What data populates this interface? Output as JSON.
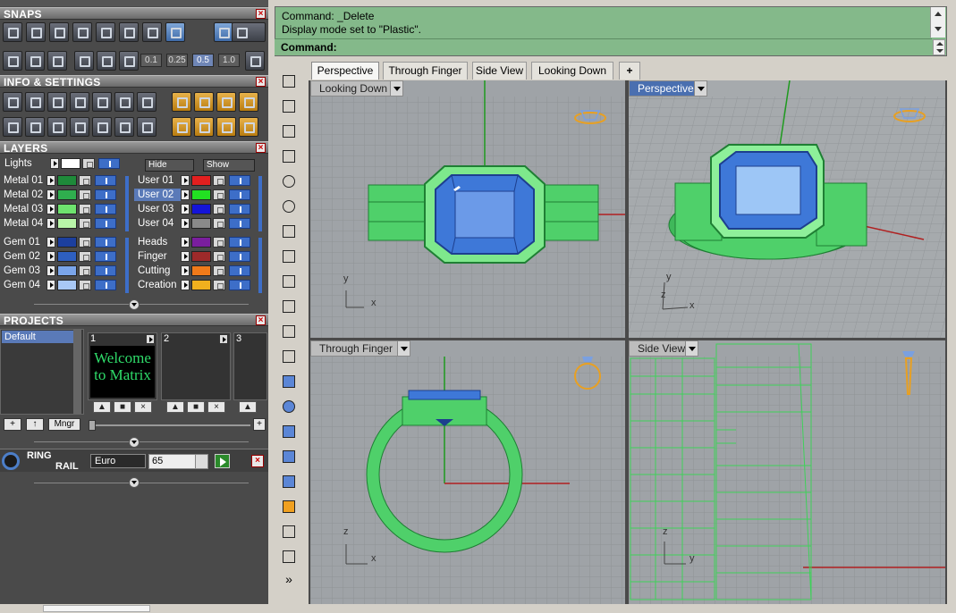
{
  "snaps": {
    "title": "SNAPS",
    "values": [
      "0.1",
      "0.25",
      "0.5",
      "1.0"
    ],
    "selected_value": "0.5"
  },
  "info": {
    "title": "INFO & SETTINGS"
  },
  "layers": {
    "title": "LAYERS",
    "lights_label": "Lights",
    "hide_label": "Hide",
    "show_label": "Show",
    "left": [
      {
        "name": "Metal 01",
        "color": "#1e8a3a"
      },
      {
        "name": "Metal 02",
        "color": "#2fae4e"
      },
      {
        "name": "Metal 03",
        "color": "#6ee36e"
      },
      {
        "name": "Metal 04",
        "color": "#b8f5a8"
      },
      {
        "name": "Gem 01",
        "color": "#1c3f9e"
      },
      {
        "name": "Gem 02",
        "color": "#2e5fc0"
      },
      {
        "name": "Gem 03",
        "color": "#7aa5ea"
      },
      {
        "name": "Gem 04",
        "color": "#a8c8f5"
      }
    ],
    "right": [
      {
        "name": "User 01",
        "color": "#e21f1f"
      },
      {
        "name": "User 02",
        "color": "#22e022"
      },
      {
        "name": "User 03",
        "color": "#1414d8"
      },
      {
        "name": "User 04",
        "color": "#8a8a8a"
      },
      {
        "name": "Heads",
        "color": "#7a1e9e"
      },
      {
        "name": "Finger",
        "color": "#9e2a2a"
      },
      {
        "name": "Cutting",
        "color": "#f07a1a"
      },
      {
        "name": "Creation",
        "color": "#f0b01e"
      }
    ],
    "selected": "User 02"
  },
  "projects": {
    "title": "PROJECTS",
    "items": [
      "Default"
    ],
    "slots": [
      {
        "num": "1",
        "preview": "Welcome to Matrix"
      },
      {
        "num": "2",
        "preview": ""
      },
      {
        "num": "3",
        "preview": ""
      }
    ],
    "mngr_label": "Mngr"
  },
  "ring_rail": {
    "title_line1": "RING",
    "title_line2": "RAIL",
    "size_system": "Euro",
    "size_value": "65"
  },
  "command": {
    "lines": [
      "Command: _Delete",
      "Display mode set to \"Plastic\"."
    ],
    "prompt": "Command:"
  },
  "tabs": [
    {
      "label": "Perspective",
      "active": true
    },
    {
      "label": "Through Finger",
      "active": false
    },
    {
      "label": "Side View",
      "active": false
    },
    {
      "label": "Looking Down",
      "active": false
    },
    {
      "label": "+",
      "active": false
    }
  ],
  "viewports": [
    {
      "label": "Looking Down",
      "active": false,
      "axes": [
        "y",
        "x"
      ]
    },
    {
      "label": "Perspective",
      "active": true,
      "axes": [
        "y",
        "z",
        "x"
      ]
    },
    {
      "label": "Through Finger",
      "active": false,
      "axes": [
        "z",
        "x"
      ]
    },
    {
      "label": "Side View",
      "active": false,
      "axes": [
        "z",
        "y"
      ]
    }
  ],
  "colors": {
    "metal": "#4fd06a",
    "gem": "#3e78d8",
    "grid": "#8f9396",
    "cmd_bg": "#84b98a",
    "accent": "#4a6fb0"
  },
  "toolbar_icons": [
    "select-arrow-icon",
    "point-icon",
    "polyline-icon",
    "curve-edit-icon",
    "circle-icon",
    "ellipse-icon",
    "arc-icon",
    "rectangle-icon",
    "polygon-icon",
    "fillet-icon",
    "surface-icon",
    "loft-icon",
    "box-icon",
    "spheres-icon",
    "cylinder-icon",
    "gem-plane-icon",
    "puzzle-icon",
    "sun-icon",
    "rail-icon",
    "wrench-icon",
    "more-icon"
  ]
}
